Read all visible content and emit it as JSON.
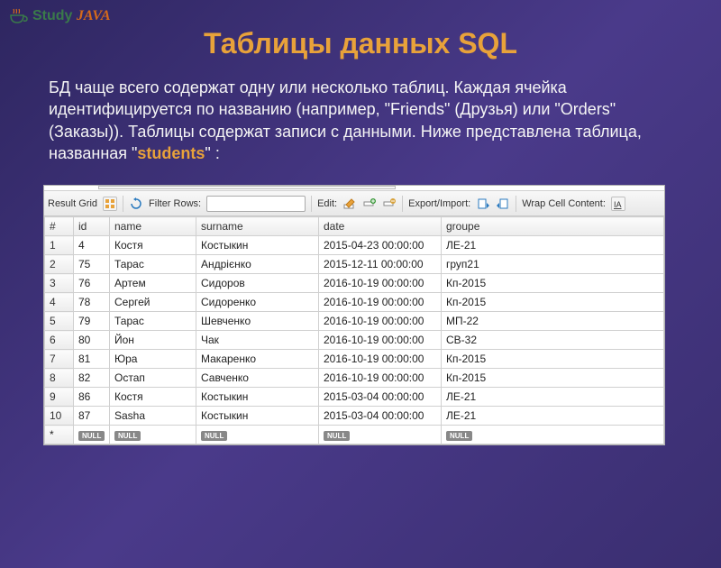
{
  "logo": {
    "study": "Study",
    "java": "JAVA"
  },
  "title": "Таблицы данных SQL",
  "description_pre": "БД чаще всего содержат одну или несколько таблиц. Каждая ячейка идентифицируется по названию (например, \"Friends\" (Друзья) или \"Orders\" (Заказы)). Таблицы содержат записи с данными. Ниже представлена таблица, названная \"",
  "description_highlight": "students",
  "description_post": "\" :",
  "toolbar": {
    "result_grid": "Result Grid",
    "filter_rows": "Filter Rows:",
    "filter_placeholder": "",
    "edit": "Edit:",
    "export_import": "Export/Import:",
    "wrap_cell": "Wrap Cell Content:"
  },
  "columns": [
    "#",
    "id",
    "name",
    "surname",
    "date",
    "groupe"
  ],
  "rows": [
    {
      "n": "1",
      "id": "4",
      "name": "Костя",
      "surname": "Костыкин",
      "date": "2015-04-23 00:00:00",
      "groupe": "ЛЕ-21"
    },
    {
      "n": "2",
      "id": "75",
      "name": "Тарас",
      "surname": "Андрієнко",
      "date": "2015-12-11 00:00:00",
      "groupe": "груп21"
    },
    {
      "n": "3",
      "id": "76",
      "name": "Артем",
      "surname": "Сидоров",
      "date": "2016-10-19 00:00:00",
      "groupe": "Кп-2015"
    },
    {
      "n": "4",
      "id": "78",
      "name": "Сергей",
      "surname": "Сидоренко",
      "date": "2016-10-19 00:00:00",
      "groupe": "Кп-2015"
    },
    {
      "n": "5",
      "id": "79",
      "name": "Тарас",
      "surname": "Шевченко",
      "date": "2016-10-19 00:00:00",
      "groupe": "МП-22"
    },
    {
      "n": "6",
      "id": "80",
      "name": "Йон",
      "surname": "Чак",
      "date": "2016-10-19 00:00:00",
      "groupe": "СВ-32"
    },
    {
      "n": "7",
      "id": "81",
      "name": "Юра",
      "surname": "Макаренко",
      "date": "2016-10-19 00:00:00",
      "groupe": "Кп-2015"
    },
    {
      "n": "8",
      "id": "82",
      "name": "Остап",
      "surname": "Савченко",
      "date": "2016-10-19 00:00:00",
      "groupe": "Кп-2015"
    },
    {
      "n": "9",
      "id": "86",
      "name": "Костя",
      "surname": "Костыкин",
      "date": "2015-03-04 00:00:00",
      "groupe": "ЛЕ-21"
    },
    {
      "n": "10",
      "id": "87",
      "name": "Sasha",
      "surname": "Костыкин",
      "date": "2015-03-04 00:00:00",
      "groupe": "ЛЕ-21"
    }
  ],
  "null_label": "NULL",
  "null_row_hash": "*"
}
